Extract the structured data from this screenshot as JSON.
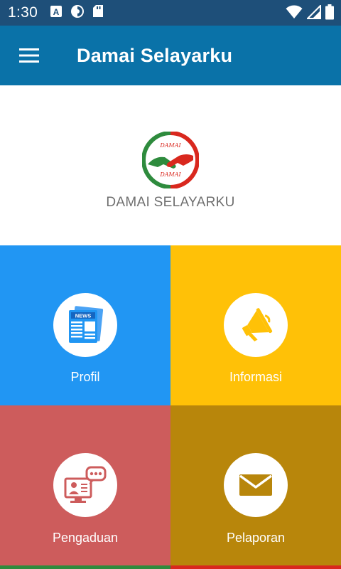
{
  "status_bar": {
    "time": "1:30",
    "icons": [
      "a-square-icon",
      "data-saver-icon",
      "sd-card-icon",
      "wifi-icon",
      "signal-icon",
      "battery-icon"
    ]
  },
  "app_bar": {
    "title": "Damai Selayarku",
    "menu_icon": "hamburger-menu-icon"
  },
  "header": {
    "logo_text_top": "DAMAI",
    "logo_text_bottom": "DAMAI",
    "brand_name": "DAMAI SELAYARKU"
  },
  "menu": {
    "items": [
      {
        "label": "Profil",
        "icon": "newspaper-icon",
        "color": "#2196f3"
      },
      {
        "label": "Informasi",
        "icon": "megaphone-icon",
        "color": "#ffc107"
      },
      {
        "label": "Pengaduan",
        "icon": "video-chat-icon",
        "color": "#cd5c5c"
      },
      {
        "label": "Pelaporan",
        "icon": "envelope-icon",
        "color": "#b8860b"
      }
    ]
  },
  "colors": {
    "status_bar": "#1e4f79",
    "app_bar": "#0a72a8"
  }
}
